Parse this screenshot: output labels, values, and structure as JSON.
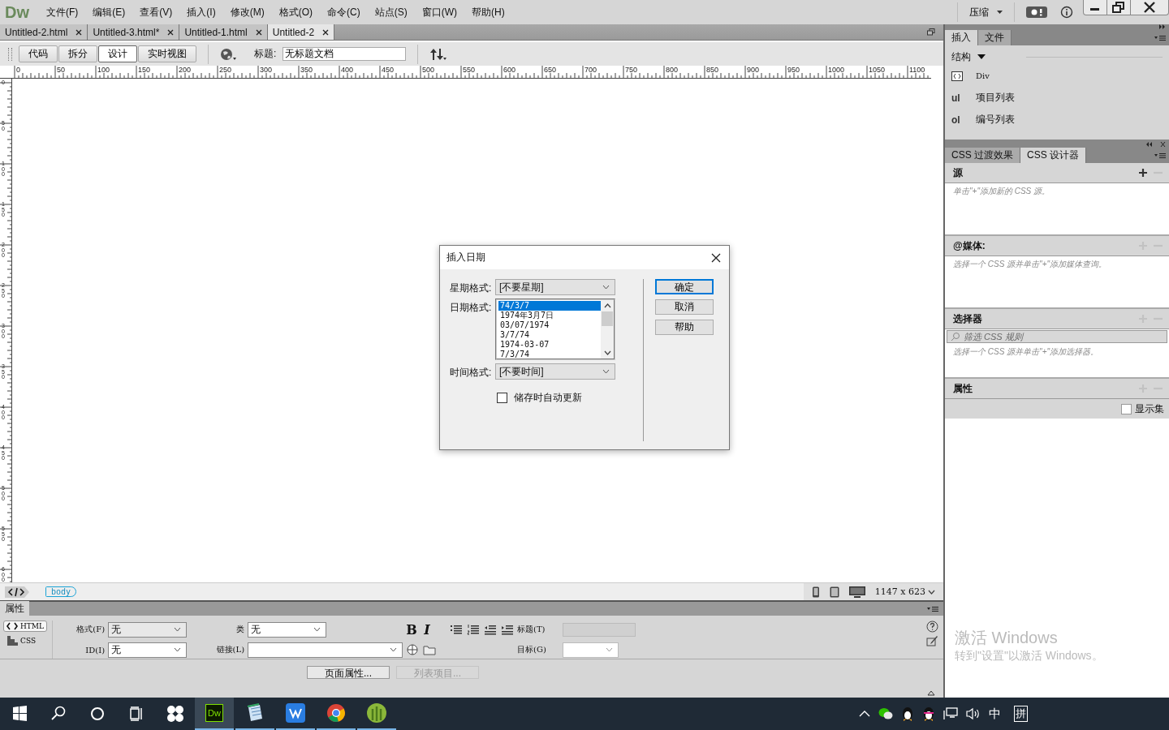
{
  "menu_bar": {
    "logo": "Dw",
    "items": [
      "文件(F)",
      "编辑(E)",
      "查看(V)",
      "插入(I)",
      "修改(M)",
      "格式(O)",
      "命令(C)",
      "站点(S)",
      "窗口(W)",
      "帮助(H)"
    ],
    "compress": "压缩"
  },
  "document_tabs": [
    {
      "label": "Untitled-2.html",
      "selected": false
    },
    {
      "label": "Untitled-3.html*",
      "selected": false
    },
    {
      "label": "Untitled-1.html",
      "selected": false
    },
    {
      "label": "Untitled-2",
      "selected": true
    }
  ],
  "doc_toolbar": {
    "views": [
      {
        "label": "代码",
        "selected": false
      },
      {
        "label": "拆分",
        "selected": false
      },
      {
        "label": "设计",
        "selected": true
      },
      {
        "label": "实时视图",
        "selected": false
      }
    ],
    "title_label": "标题:",
    "title_value": "无标题文档"
  },
  "ruler": {
    "horizontal": [
      "0",
      "50",
      "100",
      "150",
      "200",
      "250",
      "300",
      "350",
      "400",
      "450",
      "500",
      "550",
      "600",
      "650",
      "700",
      "750",
      "800",
      "850",
      "900",
      "950",
      "1000",
      "1050",
      "1100"
    ],
    "vertical": [
      "0",
      "50",
      "100",
      "150",
      "200",
      "250",
      "300",
      "350",
      "400",
      "450",
      "500",
      "550",
      "600"
    ]
  },
  "dialog": {
    "title": "插入日期",
    "weekday_label": "星期格式:",
    "weekday_value": "[不要星期]",
    "date_label": "日期格式:",
    "date_options": [
      {
        "label": "74/3/7",
        "selected": true
      },
      {
        "label": "1974年3月7日",
        "selected": false
      },
      {
        "label": "03/07/1974",
        "selected": false
      },
      {
        "label": "3/7/74",
        "selected": false
      },
      {
        "label": "1974-03-07",
        "selected": false
      },
      {
        "label": "7/3/74",
        "selected": false
      }
    ],
    "time_label": "时间格式:",
    "time_value": "[不要时间]",
    "auto_update": {
      "label": "储存时自动更新",
      "checked": false
    },
    "buttons": [
      {
        "label": "确定",
        "default": true
      },
      {
        "label": "取消",
        "default": false
      },
      {
        "label": "帮助",
        "default": false
      }
    ]
  },
  "status_bar": {
    "tag": "body",
    "size": "1147 x 623"
  },
  "properties": {
    "tab": "属性",
    "modes": [
      {
        "label": "HTML",
        "selected": true
      },
      {
        "label": "CSS",
        "selected": false
      }
    ],
    "format_label": "格式(F)",
    "format_value": "无",
    "id_label": "ID(I)",
    "id_value": "无",
    "class_label": "类",
    "class_value": "无",
    "bold": "B",
    "italic": "I",
    "link_label": "链接(L)",
    "title_label": "标题(T)",
    "target_label": "目标(G)",
    "page_props": {
      "label": "页面属性...",
      "disabled": false
    },
    "list_item": {
      "label": "列表项目...",
      "disabled": true
    }
  },
  "insert_panel": {
    "tabs": [
      {
        "label": "插入",
        "selected": true
      },
      {
        "label": "文件",
        "selected": false
      }
    ],
    "category": "结构",
    "items": [
      {
        "kind": "icon",
        "label": "Div"
      },
      {
        "kind": "glyph",
        "glyph": "ul",
        "label": "项目列表"
      },
      {
        "kind": "glyph",
        "glyph": "ol",
        "label": "编号列表"
      }
    ]
  },
  "css_panel": {
    "tabs": [
      {
        "label": "CSS 过渡效果",
        "selected": false
      },
      {
        "label": "CSS 设计器",
        "selected": true
      }
    ],
    "sections": [
      {
        "kind": "source",
        "title": "源",
        "add_enabled": true,
        "hint": "单击\"+\"添加新的 CSS 源。"
      },
      {
        "kind": "media",
        "title": "@媒体:",
        "add_enabled": false,
        "hint": "选择一个 CSS 源并单击\"+\"添加媒体查询。"
      },
      {
        "kind": "selector",
        "title": "选择器",
        "add_enabled": false,
        "filter_placeholder": "筛选 CSS 规则",
        "hint": "选择一个 CSS 源并单击\"+\"添加选择器。"
      },
      {
        "kind": "properties",
        "title": "属性",
        "add_enabled": false,
        "show_set": {
          "label": "显示集",
          "checked": false
        }
      }
    ]
  },
  "activation": {
    "title": "激活 Windows",
    "text": "转到\"设置\"以激活 Windows。"
  },
  "taskbar": {
    "apps": [
      {
        "kind": "dw",
        "label": "Dw",
        "active": true
      },
      {
        "kind": "notepad",
        "active": false
      },
      {
        "kind": "wps",
        "active": false
      },
      {
        "kind": "chrome",
        "active": false
      },
      {
        "kind": "cactus",
        "active": false
      }
    ],
    "tray": {
      "ime_lang": "中",
      "ime_mode": "拼"
    }
  }
}
